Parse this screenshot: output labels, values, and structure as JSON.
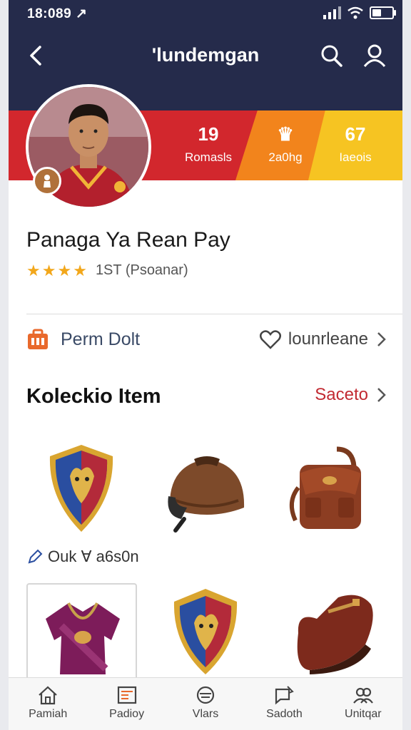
{
  "status": {
    "time": "18:089 ↗"
  },
  "header": {
    "title": "'lundemgan"
  },
  "stats": [
    {
      "value": "19",
      "label": "Romasls"
    },
    {
      "value": "♛",
      "label": "2a0hg"
    },
    {
      "value": "67",
      "label": "Iaeois"
    }
  ],
  "profile": {
    "name": "Panaga Ya Rean Pay",
    "rating_text": "1ST (Psoanar)",
    "stars": 4
  },
  "actions": {
    "left_label": "Perm Dolt",
    "right_label": "lounrleane"
  },
  "section": {
    "title": "Koleckio Item",
    "link": "Saceto"
  },
  "sub_label": "Ouk ∀ a6s0n",
  "items": [
    {
      "icon": "crest-icon"
    },
    {
      "icon": "helmet-icon"
    },
    {
      "icon": "backpack-icon"
    },
    {
      "icon": "jersey-icon"
    },
    {
      "icon": "crest-icon"
    },
    {
      "icon": "shoe-icon"
    }
  ],
  "tabs": [
    {
      "label": "Pamiah",
      "icon": "home-icon"
    },
    {
      "label": "Padioy",
      "icon": "news-icon"
    },
    {
      "label": "Vlars",
      "icon": "ball-icon"
    },
    {
      "label": "Sadoth",
      "icon": "chat-icon"
    },
    {
      "label": "Unitqar",
      "icon": "users-icon"
    }
  ],
  "colors": {
    "header_bg": "#252b4b",
    "band_red": "#d2272d",
    "band_orange": "#f2841c",
    "band_yellow": "#f6c422",
    "accent": "#c22a32"
  }
}
